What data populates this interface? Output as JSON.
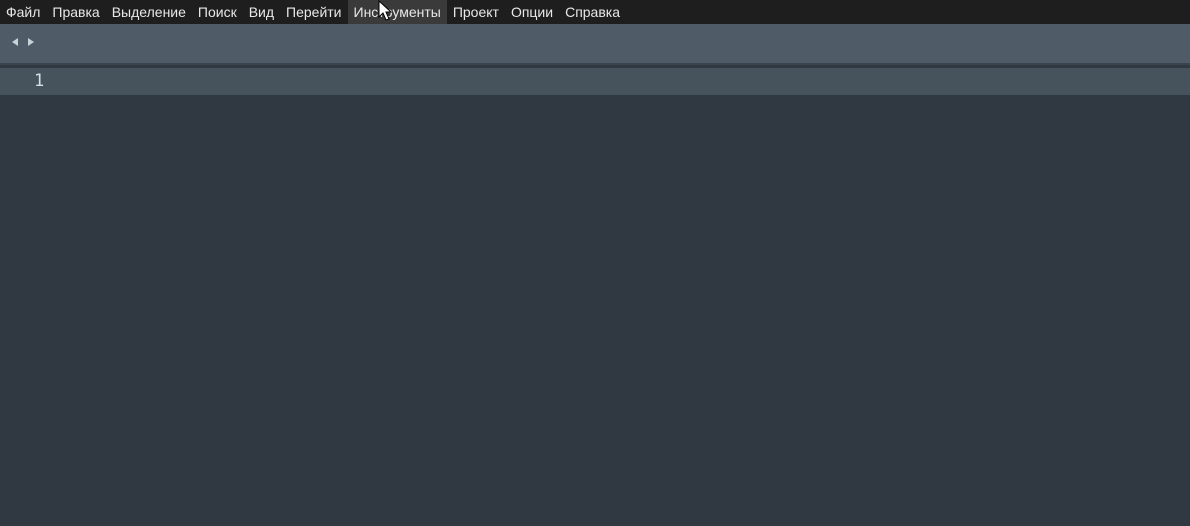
{
  "menubar": {
    "items": [
      {
        "label": "Файл"
      },
      {
        "label": "Правка"
      },
      {
        "label": "Выделение"
      },
      {
        "label": "Поиск"
      },
      {
        "label": "Вид"
      },
      {
        "label": "Перейти"
      },
      {
        "label": "Инструменты",
        "active": true
      },
      {
        "label": "Проект"
      },
      {
        "label": "Опции"
      },
      {
        "label": "Справка"
      }
    ]
  },
  "tabbar": {
    "icons": [
      "chevron-left-icon",
      "chevron-right-icon"
    ]
  },
  "editor": {
    "line_numbers": [
      "1"
    ],
    "lines": [
      ""
    ]
  },
  "colors": {
    "menubar_bg": "#1e1e1e",
    "tabbar_bg": "#4f5b66",
    "editor_bg": "#303841",
    "current_line_bg": "#46535d",
    "text": "#d8dee9"
  }
}
